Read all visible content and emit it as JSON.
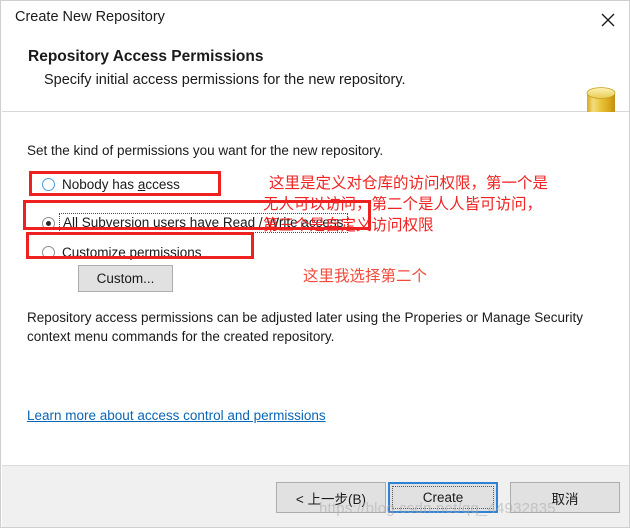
{
  "window": {
    "title": "Create New Repository",
    "close_icon": "close-icon"
  },
  "header": {
    "title": "Repository Access Permissions",
    "subtitle": "Specify initial access permissions for the new repository.",
    "icon": "database-cylinder-icon"
  },
  "main": {
    "intro": "Set the kind of permissions you want for the new repository.",
    "options": [
      {
        "label_pre": "Nobody has ",
        "label_underline": "a",
        "label_post": "ccess",
        "selected": false
      },
      {
        "label_pre": "All Subversion users have Read / ",
        "label_underline": "W",
        "label_post": "rite access",
        "selected": true
      },
      {
        "label_pre": "",
        "label_underline": "C",
        "label_post": "ustomize permissions",
        "selected": false
      }
    ],
    "custom_button": "Custom...",
    "description": "Repository access permissions can be adjusted later using the Properies or Manage Security context menu commands for the created repository.",
    "learn_link": "Learn more about access control and permissions"
  },
  "annotations": {
    "note_line1": "这里是定义对仓库的访问权限，第一个是",
    "note_line2": "无人可以访问，第二个是人人皆可访问，",
    "note_line3": "第三个是自定义访问权限",
    "note_bottom": "这里我选择第二个"
  },
  "footer": {
    "back": "< 上一步(B)",
    "create": "Create",
    "cancel": "取消"
  },
  "watermark": "https://blog.csdn.net/qq_44932835",
  "colors": {
    "annotation_red": "#f02222",
    "link_blue": "#0b66b5",
    "accent_blue": "#2f82d4",
    "icon_gold": "#e8c138"
  }
}
